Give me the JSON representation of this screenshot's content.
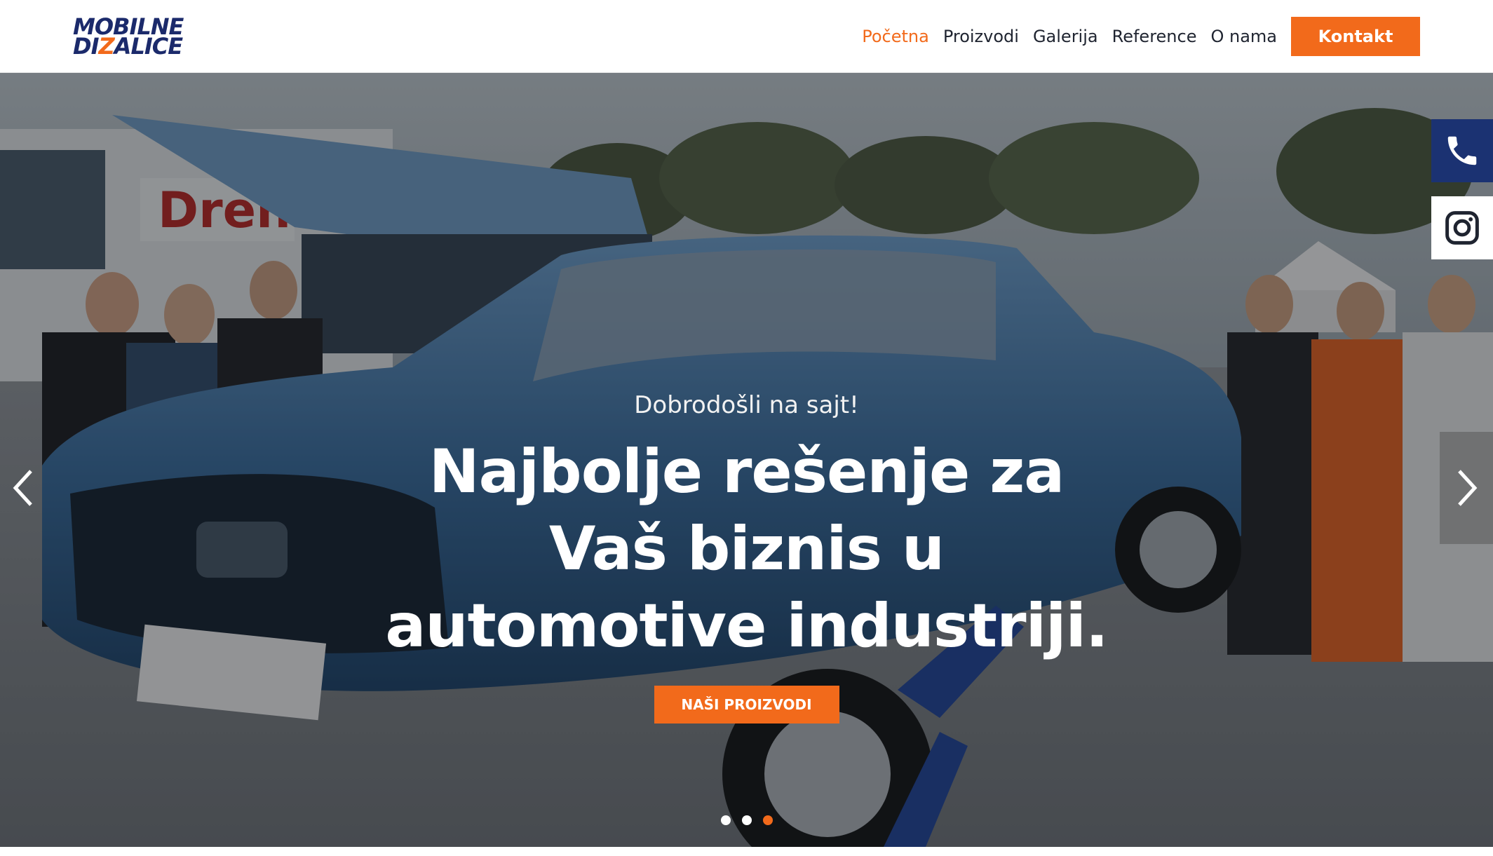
{
  "brand": {
    "logo_line1": "MOBILNE",
    "logo_line2_a": "DI",
    "logo_line2_z": "Z",
    "logo_line2_b": "ALICE",
    "primary_color": "#1b2a6b",
    "accent_color": "#f26a1b"
  },
  "nav": {
    "items": [
      {
        "label": "Početna",
        "active": true
      },
      {
        "label": "Proizvodi",
        "active": false
      },
      {
        "label": "Galerija",
        "active": false
      },
      {
        "label": "Reference",
        "active": false
      },
      {
        "label": "O nama",
        "active": false
      }
    ],
    "contact_button": "Kontakt"
  },
  "hero": {
    "kicker": "Dobrodošli na sajt!",
    "headline": "Najbolje rešenje za Vaš biznis u automotive industriji.",
    "cta_label": "NAŠI PROIZVODI",
    "slides_total": 3,
    "active_slide": 3,
    "prev_icon": "chevron-left-icon",
    "next_icon": "chevron-right-icon"
  },
  "side_links": {
    "phone_icon": "phone-icon",
    "instagram_icon": "instagram-icon"
  }
}
